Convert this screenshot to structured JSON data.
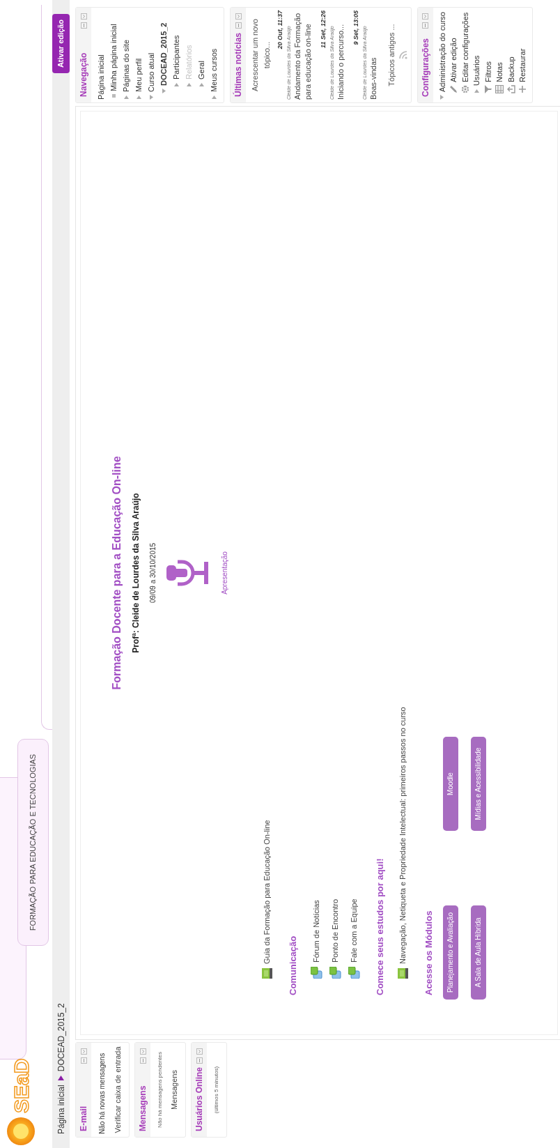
{
  "header": {
    "logo_text": "SEaD",
    "tab_label": "FORMAÇÃO PARA EDUCAÇÃO E TECNOLOGIAS"
  },
  "breadcrumb": [
    "Página inicial",
    "DOCEAD_2015_2"
  ],
  "edit_button": "Ativar edição",
  "left_blocks": [
    {
      "title": "E-mail",
      "lines": [
        {
          "text": "Não há novas mensagens",
          "kind": "line"
        },
        {
          "text": "Verificar caixa de entrada",
          "kind": "link"
        }
      ]
    },
    {
      "title": "Mensagens",
      "lines": [
        {
          "text": "Não há mensagens pendentes",
          "kind": "small"
        },
        {
          "text": "Mensagens",
          "kind": "link"
        }
      ]
    },
    {
      "title": "Usuários Online",
      "lines": [
        {
          "text": "(últimos 5 minutos)",
          "kind": "small"
        }
      ]
    }
  ],
  "course": {
    "title": "Formação Docente para a Educação On-line",
    "teacher": "Profª: Cleide de Lourdes da Silva Araújo",
    "dates": "09/09 a 30/10/2015",
    "intro_link": "Apresentação",
    "sections": [
      {
        "items": [
          {
            "label": "Guia da Formação para Educação On-line",
            "kind": "resource"
          }
        ]
      },
      {
        "heading": "Comunicação",
        "items": [
          {
            "label": "Fórum de Notícias",
            "kind": "forum"
          },
          {
            "label": "Ponto de Encontro",
            "kind": "forum"
          },
          {
            "label": "Fale com a Equipe",
            "kind": "forum"
          }
        ]
      },
      {
        "heading": "Comece seus estudos por aqui!",
        "items": [
          {
            "label": "Navegação, Netiqueta e Propriedade Intelectual: primeiros passos no curso",
            "kind": "resource"
          }
        ]
      },
      {
        "heading": "Acesse os Módulos",
        "buttons": [
          [
            "Planejamento e Avaliação",
            "Moodle"
          ],
          [
            "A Sala de Aula Híbrida",
            "Mídias e Acessibilidade"
          ]
        ]
      }
    ]
  },
  "navigation": {
    "title": "Navegação",
    "items": [
      {
        "label": "Página inicial",
        "kind": "plain",
        "disabled": false
      },
      {
        "label": "Minha página inicial",
        "kind": "bullet",
        "disabled": false
      },
      {
        "label": "Páginas do site",
        "kind": "branch",
        "expanded": false,
        "disabled": false
      },
      {
        "label": "Meu perfil",
        "kind": "branch",
        "expanded": false,
        "disabled": false
      },
      {
        "label": "Curso atual",
        "kind": "branch",
        "expanded": true,
        "disabled": false,
        "children": [
          {
            "label": "DOCEAD_2015_2",
            "kind": "branch",
            "expanded": true,
            "disabled": false,
            "children": [
              {
                "label": "Participantes",
                "kind": "branch",
                "expanded": false,
                "disabled": false
              },
              {
                "label": "Relatórios",
                "kind": "branch",
                "expanded": false,
                "disabled": true
              },
              {
                "label": "Geral",
                "kind": "branch",
                "expanded": false,
                "disabled": false
              }
            ]
          }
        ]
      },
      {
        "label": "Meus cursos",
        "kind": "branch",
        "expanded": false,
        "disabled": false
      }
    ]
  },
  "news": {
    "title": "Últimas notícias",
    "add_link": "Acrescentar um novo tópico...",
    "posts": [
      {
        "date": "20 Out, 11:37",
        "author": "Cleide de Lourdes da Silva Araújo",
        "title": "Andamento da Formação para educação on-line"
      },
      {
        "date": "11 Set, 12:26",
        "author": "Cleide de Lourdes da Silva Araújo",
        "title": "Iniciando o percurso..."
      },
      {
        "date": "9 Set, 13:05",
        "author": "Cleide de Lourdes da Silva Araújo",
        "title": "Boas-vindas"
      }
    ],
    "older_link": "Tópicos antigos ..."
  },
  "settings": {
    "title": "Configurações",
    "items": [
      {
        "label": "Administração do curso",
        "kind": "branch",
        "expanded": true,
        "children": [
          {
            "label": "Ativar edição",
            "kind": "pencil"
          },
          {
            "label": "Editar configurações",
            "kind": "gear"
          },
          {
            "label": "Usuários",
            "kind": "branch",
            "expanded": false
          },
          {
            "label": "Filtros",
            "kind": "funnel"
          },
          {
            "label": "Notas",
            "kind": "table"
          },
          {
            "label": "Backup",
            "kind": "backup"
          },
          {
            "label": "Restaurar",
            "kind": "restore"
          }
        ]
      }
    ]
  }
}
